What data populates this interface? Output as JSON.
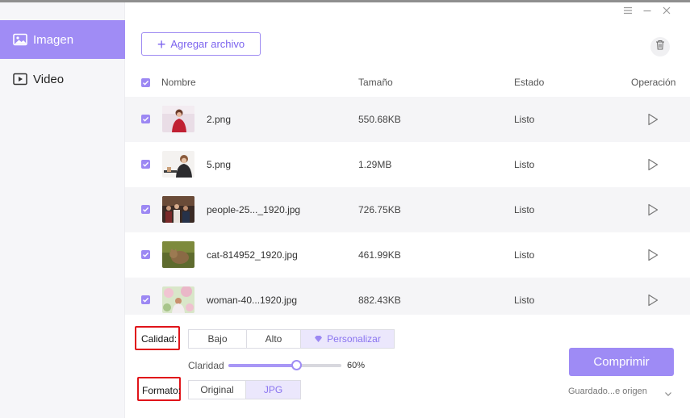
{
  "sidebar": {
    "items": [
      {
        "label": "Imagen",
        "icon": "image-icon",
        "active": true
      },
      {
        "label": "Video",
        "icon": "video-icon",
        "active": false
      }
    ]
  },
  "window": {
    "menu_icon": "menu-icon",
    "minimize_icon": "minimize-icon",
    "close_icon": "close-icon"
  },
  "toolbar": {
    "add_label": "Agregar archivo",
    "trash_icon": "trash-icon"
  },
  "table": {
    "headers": {
      "name": "Nombre",
      "size": "Tamaño",
      "state": "Estado",
      "operation": "Operación"
    },
    "rows": [
      {
        "name": "2.png",
        "size": "550.68KB",
        "state": "Listo"
      },
      {
        "name": "5.png",
        "size": "1.29MB",
        "state": "Listo"
      },
      {
        "name": "people-25..._1920.jpg",
        "size": "726.75KB",
        "state": "Listo"
      },
      {
        "name": "cat-814952_1920.jpg",
        "size": "461.99KB",
        "state": "Listo"
      },
      {
        "name": "woman-40...1920.jpg",
        "size": "882.43KB",
        "state": "Listo"
      }
    ]
  },
  "quality": {
    "label": "Calidad:",
    "options": [
      "Bajo",
      "Alto",
      "Personalizar"
    ],
    "selected": "Personalizar",
    "clarity_label": "Claridad",
    "clarity_value": 60,
    "clarity_text": "60%"
  },
  "format": {
    "label": "Formato:",
    "options": [
      "Original",
      "JPG"
    ],
    "selected": "JPG"
  },
  "actions": {
    "compress_label": "Comprimir",
    "save_to_label": "Guardado...e origen"
  },
  "colors": {
    "accent": "#9e8bf5",
    "highlight_box": "#e0141a"
  }
}
